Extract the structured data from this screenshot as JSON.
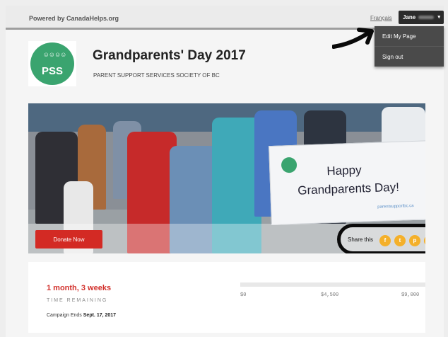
{
  "topbar": {
    "powered_by": "Powered by CanadaHelps.org",
    "language_link": "Français",
    "user_name": "Jane"
  },
  "user_menu": {
    "items": [
      {
        "label": "Edit My Page"
      },
      {
        "label": "Sign out"
      }
    ]
  },
  "campaign": {
    "logo_text": "PSS",
    "title": "Grandparents' Day 2017",
    "organization": "PARENT SUPPORT SERVICES SOCIETY OF BC"
  },
  "hero": {
    "banner_line1": "Happy",
    "banner_line2": "Grandparents Day!",
    "banner_url": "parentsupportbc.ca",
    "donate_label": "Donate Now",
    "share_label": "Share this",
    "share_icons": [
      "facebook-icon",
      "twitter-icon",
      "pinterest-icon",
      "email-icon"
    ]
  },
  "stats": {
    "time_value": "1 month, 3 weeks",
    "time_label": "TIME REMAINING",
    "ends_prefix": "Campaign Ends",
    "ends_date": "Sept. 17, 2017",
    "progress_fraction": 0,
    "ticks": [
      "$0",
      "$4,500",
      "$9,000"
    ]
  },
  "colors": {
    "accent_red": "#d32a24",
    "share_orange": "#f4b02a",
    "logo_green": "#3aa46f"
  }
}
